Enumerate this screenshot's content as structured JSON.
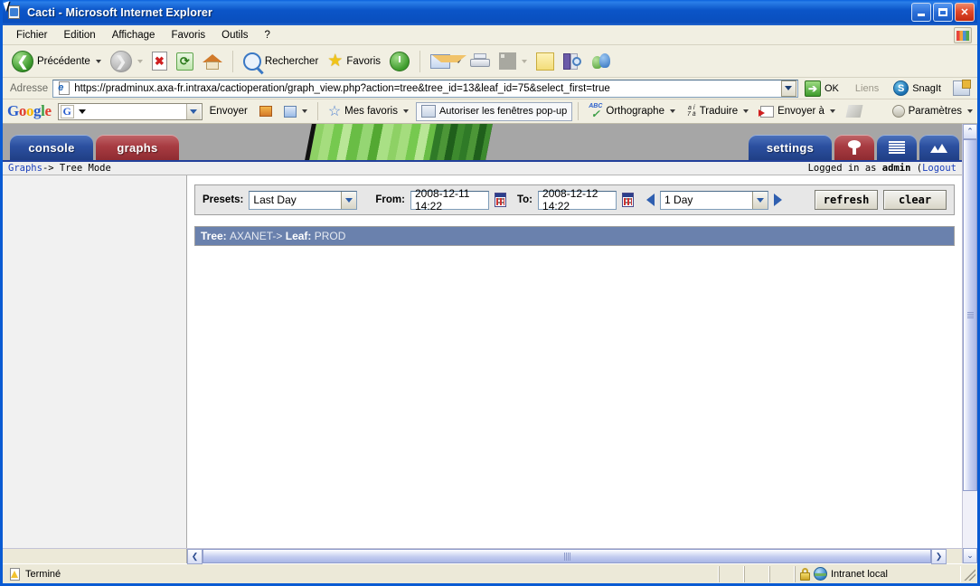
{
  "window": {
    "title": "Cacti - Microsoft Internet Explorer",
    "minimize_label": "Minimize",
    "maximize_label": "Maximize",
    "close_label": "Close"
  },
  "menu": {
    "items": [
      {
        "label": "Fichier"
      },
      {
        "label": "Edition"
      },
      {
        "label": "Affichage"
      },
      {
        "label": "Favoris"
      },
      {
        "label": "Outils"
      },
      {
        "label": "?"
      }
    ]
  },
  "toolbar": {
    "back_label": "Précédente",
    "forward_label": "",
    "stop_label": "",
    "refresh_label": "",
    "home_label": "",
    "search_label": "Rechercher",
    "favorites_label": "Favoris",
    "history_label": "",
    "mail_label": "",
    "print_label": "",
    "edit_label": "",
    "notes_label": "",
    "research_label": "",
    "messenger_label": ""
  },
  "address": {
    "label": "Adresse",
    "url": "https://pradminux.axa-fr.intraxa/cactioperation/graph_view.php?action=tree&tree_id=13&leaf_id=75&select_first=true",
    "go_label": "OK",
    "links_label": "Liens",
    "snagit_label": "SnagIt"
  },
  "google_toolbar": {
    "logo_g1": "G",
    "logo_o1": "o",
    "logo_o2": "o",
    "logo_g2": "g",
    "logo_l": "l",
    "logo_e": "e",
    "search_value": "",
    "search_engine_icon": "G",
    "send_label": "Envoyer",
    "bookmarks_label": "Mes favoris",
    "popup_label": "Autoriser les fenêtres pop-up",
    "spell_label": "Orthographe",
    "abc_label": "ABC",
    "translate_label": "Traduire",
    "translate_glyph_top": "a í",
    "translate_glyph_bottom": "7 ä",
    "sendto_label": "Envoyer à",
    "settings_label": "Paramètres"
  },
  "cacti": {
    "tabs": [
      {
        "label": "console",
        "color": "blue"
      },
      {
        "label": "graphs",
        "color": "red"
      }
    ],
    "right_tabs": [
      {
        "label": "settings",
        "color": "blue",
        "icon": ""
      },
      {
        "label": "",
        "color": "red",
        "icon": "tree-icon"
      },
      {
        "label": "",
        "color": "blue",
        "icon": "list-icon"
      },
      {
        "label": "",
        "color": "blue",
        "icon": "chart-icon"
      }
    ],
    "breadcrumb_link": "Graphs",
    "breadcrumb_sep": "-> ",
    "breadcrumb_current": "Tree Mode",
    "login_prefix": "Logged in as ",
    "login_user": "admin",
    "login_paren_open": " (",
    "logout_label": "Logout",
    "filter": {
      "presets_label": "Presets:",
      "presets_value": "Last Day",
      "from_label": "From:",
      "from_value": "2008-12-11 14:22",
      "to_label": "To:",
      "to_value": "2008-12-12 14:22",
      "span_value": "1 Day",
      "refresh_label": "refresh",
      "clear_label": "clear"
    },
    "tree_header": {
      "tree_label": "Tree:",
      "tree_value": "AXANET->",
      "leaf_label": "Leaf:",
      "leaf_value": "PROD"
    }
  },
  "statusbar": {
    "status_text": "Terminé",
    "zone_text": "Intranet local"
  },
  "colors": {
    "titlebar_blue": "#0b55c8",
    "cacti_header_grey": "#a6a6a6",
    "tab_blue": "#2c50a0",
    "tab_red": "#a83c42",
    "tree_bar_blue": "#6a81ad",
    "link_blue": "#1a3fbb"
  }
}
